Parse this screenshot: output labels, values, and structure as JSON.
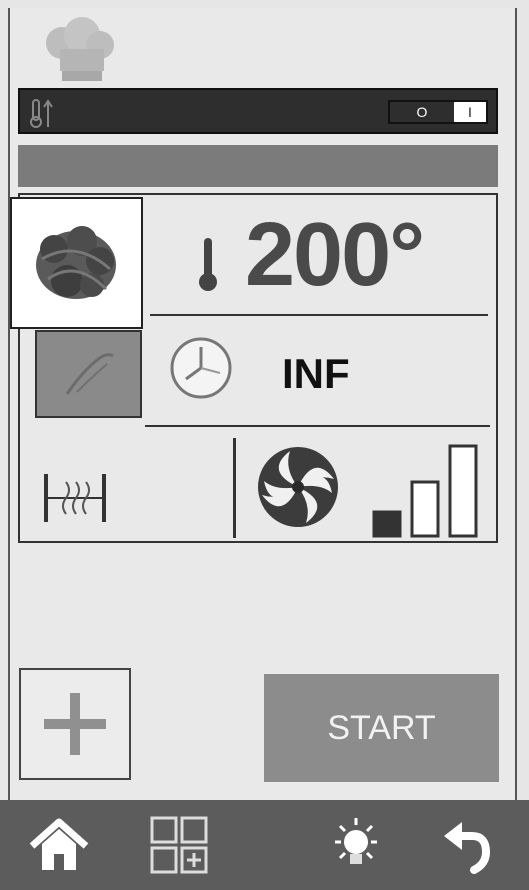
{
  "header": {
    "chef_icon": "chef-hat-icon",
    "temperature_icon": "thermometer-arrows-icon",
    "toggle": {
      "off_label": "O",
      "on_label": "I",
      "state": "off"
    }
  },
  "settings": {
    "food_icon": "roast-food-icon",
    "steam_icon": "steam-icon",
    "temperature_value": "200°",
    "time_value": "INF",
    "fan_level": 1,
    "fan_levels": 3
  },
  "actions": {
    "add_icon": "plus-icon",
    "start_label": "START"
  },
  "bottom_nav": [
    "home-icon",
    "add-program-icon",
    "light-bulb-icon",
    "back-arrow-icon"
  ],
  "colors": {
    "dark": "#2e2e2e",
    "button": "#8c8c8c",
    "nav": "#5c5c5c"
  }
}
